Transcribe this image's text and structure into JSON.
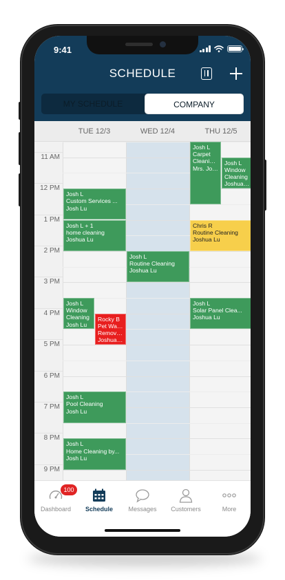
{
  "status": {
    "time": "9:41"
  },
  "header": {
    "title": "SCHEDULE"
  },
  "segments": {
    "my": "MY SCHEDULE",
    "company": "COMPANY",
    "selected": "company"
  },
  "days": [
    {
      "label": "TUE 12/3"
    },
    {
      "label": "WED 12/4"
    },
    {
      "label": "THU 12/5"
    }
  ],
  "hours": [
    "11 AM",
    "12 PM",
    "1 PM",
    "2 PM",
    "3 PM",
    "4 PM",
    "5 PM",
    "6 PM",
    "7 PM",
    "8 PM",
    "9 PM"
  ],
  "events": [
    {
      "day": 0,
      "start": 12.0,
      "end": 13.0,
      "lane": 0,
      "lanes": 1,
      "color": "green",
      "lines": [
        "Josh L",
        "Custom Services ...",
        "Josh Lu"
      ]
    },
    {
      "day": 0,
      "start": 13.0,
      "end": 14.0,
      "lane": 0,
      "lanes": 1,
      "color": "green",
      "lines": [
        "Josh L + 1",
        "home cleaning",
        "Joshua Lu"
      ]
    },
    {
      "day": 0,
      "start": 15.5,
      "end": 16.5,
      "lane": 0,
      "lanes": 2,
      "color": "green",
      "lines": [
        "Josh L",
        "Window",
        "Cleaning",
        "Josh Lu"
      ]
    },
    {
      "day": 0,
      "start": 16.0,
      "end": 17.0,
      "lane": 1,
      "lanes": 2,
      "color": "red",
      "lines": [
        "Rocky B",
        "Pet Waste",
        "Remova...",
        "Joshua Lu"
      ]
    },
    {
      "day": 0,
      "start": 18.5,
      "end": 19.5,
      "lane": 0,
      "lanes": 1,
      "color": "green",
      "lines": [
        "Josh L",
        "Pool Cleaning",
        "Josh Lu"
      ]
    },
    {
      "day": 0,
      "start": 20.0,
      "end": 21.0,
      "lane": 0,
      "lanes": 1,
      "color": "green",
      "lines": [
        "Josh L",
        "Home Cleaning by...",
        "Josh Lu"
      ]
    },
    {
      "day": 1,
      "start": 14.0,
      "end": 15.0,
      "lane": 0,
      "lanes": 1,
      "color": "green",
      "lines": [
        "Josh L",
        "Routine Cleaning",
        "Joshua Lu"
      ]
    },
    {
      "day": 2,
      "start": 10.5,
      "end": 12.5,
      "lane": 0,
      "lanes": 2,
      "color": "green",
      "lines": [
        "Josh L",
        "Carpet",
        "Cleaning ...",
        "Mrs. Jones"
      ]
    },
    {
      "day": 2,
      "start": 11.0,
      "end": 12.0,
      "lane": 1,
      "lanes": 2,
      "color": "green",
      "lines": [
        "Josh L",
        "Window",
        "Cleaning",
        "Joshua Lu"
      ]
    },
    {
      "day": 2,
      "start": 13.0,
      "end": 14.0,
      "lane": 0,
      "lanes": 1,
      "color": "yellow",
      "lines": [
        "Chris R",
        "Routine Cleaning",
        "Joshua Lu"
      ]
    },
    {
      "day": 2,
      "start": 15.5,
      "end": 16.5,
      "lane": 0,
      "lanes": 1,
      "color": "green",
      "lines": [
        "Josh L",
        "Solar Panel Clea...",
        "Joshua Lu"
      ]
    }
  ],
  "tabs": [
    {
      "label": "Dashboard",
      "icon": "gauge-icon",
      "badge": "100"
    },
    {
      "label": "Schedule",
      "icon": "calendar-icon",
      "active": true
    },
    {
      "label": "Messages",
      "icon": "chat-bubble-icon"
    },
    {
      "label": "Customers",
      "icon": "person-icon"
    },
    {
      "label": "More",
      "icon": "more-dots-icon"
    }
  ],
  "colors": {
    "header": "#133c59",
    "green": "#3e9a5b",
    "red": "#e81e1e",
    "yellow": "#f7cf4b",
    "badge": "#e02424"
  }
}
